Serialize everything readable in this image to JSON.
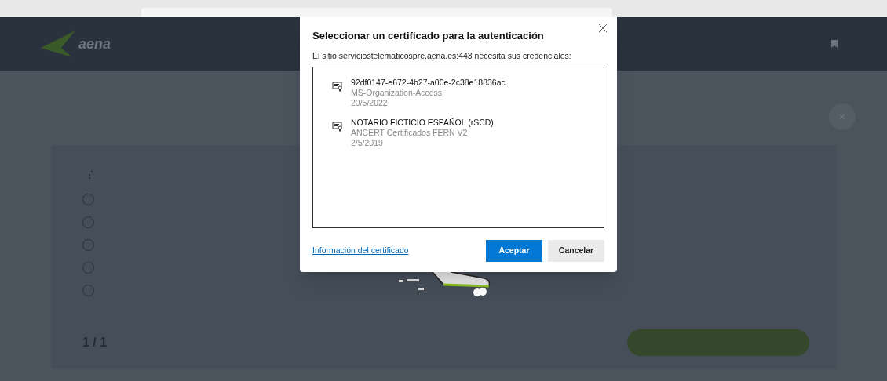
{
  "header": {
    "logo_text": "aena"
  },
  "question": {
    "options": [
      {
        "selected": false
      },
      {
        "selected": false
      },
      {
        "selected": false
      },
      {
        "selected": false
      },
      {
        "selected": false
      }
    ],
    "pager": "1 / 1"
  },
  "dialog": {
    "title": "Seleccionar un certificado para la autenticación",
    "message": "El sitio serviciostelematicospre.aena.es:443 necesita sus credenciales:",
    "certificates": [
      {
        "name": "92df0147-e672-4b27-a00e-2c38e18836ac",
        "issuer": "MS-Organization-Access",
        "date": "20/5/2022",
        "selected": false
      },
      {
        "name": "NOTARIO FICTICIO ESPAÑOL (rSCD)",
        "issuer": "ANCERT Certificados FERN V2",
        "date": "2/5/2019",
        "selected": false
      }
    ],
    "link": "Información del certificado",
    "buttons": [
      {
        "label": "Aceptar",
        "kind": "primary"
      },
      {
        "label": "Cancelar",
        "kind": "secondary"
      }
    ]
  }
}
